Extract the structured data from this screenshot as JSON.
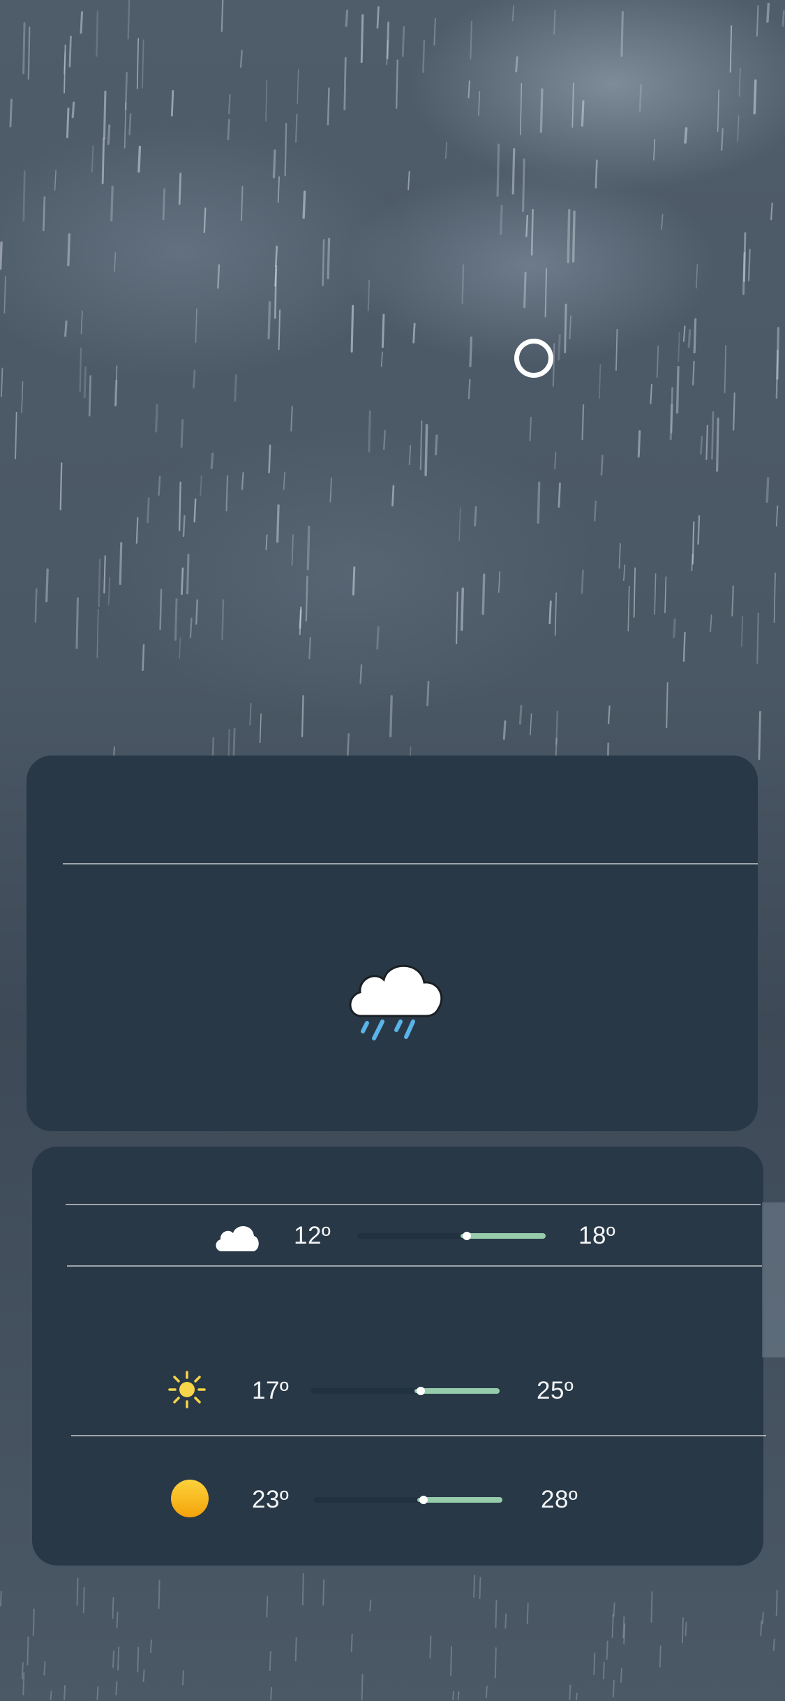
{
  "theme": {
    "card_color": "#293846",
    "range_fill_color": "#96ccab",
    "sun_color": "#f7d54a",
    "sun_disc_color": "#f8b40a",
    "rain_drop_color": "#5ab4e8"
  },
  "current": {
    "condition_icon": "cloud-rain-icon"
  },
  "daily": [
    {
      "icon": "cloud-icon",
      "low": "12º",
      "high": "18º",
      "range": {
        "low": 0.58,
        "high": 1.0,
        "current": 0.58
      }
    },
    {
      "icon": "sun-outline-icon",
      "low": "17º",
      "high": "25º",
      "range": {
        "low": 0.58,
        "high": 1.0,
        "current": 0.58
      }
    },
    {
      "icon": "sun-disc-icon",
      "low": "23º",
      "high": "28º",
      "range": {
        "low": 0.58,
        "high": 1.0,
        "current": 0.58
      }
    }
  ]
}
